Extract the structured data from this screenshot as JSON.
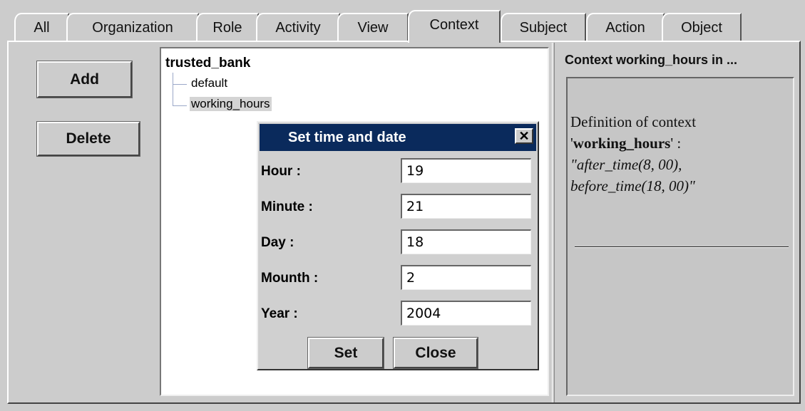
{
  "tabs": [
    {
      "label": "All"
    },
    {
      "label": "Organization"
    },
    {
      "label": "Role"
    },
    {
      "label": "Activity"
    },
    {
      "label": "View"
    },
    {
      "label": "Context"
    },
    {
      "label": "Subject"
    },
    {
      "label": "Action"
    },
    {
      "label": "Object"
    }
  ],
  "active_tab": "Context",
  "buttons": {
    "add": "Add",
    "delete": "Delete"
  },
  "tree": {
    "root": "trusted_bank",
    "children": [
      {
        "label": "default"
      },
      {
        "label": "working_hours"
      }
    ]
  },
  "detail": {
    "title": "Context working_hours in ...",
    "line1": "Definition of context",
    "quote_open": "'",
    "name": "working_hours",
    "quote_close": "' :",
    "expr1": "\"after_time(8, 00),",
    "expr2": "before_time(18, 00)\""
  },
  "dialog": {
    "title": "Set time and date",
    "close_glyph": "✕",
    "fields": [
      {
        "label": "Hour :",
        "value": "19"
      },
      {
        "label": "Minute :",
        "value": "21"
      },
      {
        "label": "Day :",
        "value": "18"
      },
      {
        "label": "Mounth :",
        "value": "2"
      },
      {
        "label": "Year :",
        "value": "2004"
      }
    ],
    "set_label": "Set",
    "close_label": "Close"
  },
  "colors": {
    "titlebar": "#0a2a5c",
    "panel": "#cccccc",
    "selection": "#d4d4d4"
  }
}
